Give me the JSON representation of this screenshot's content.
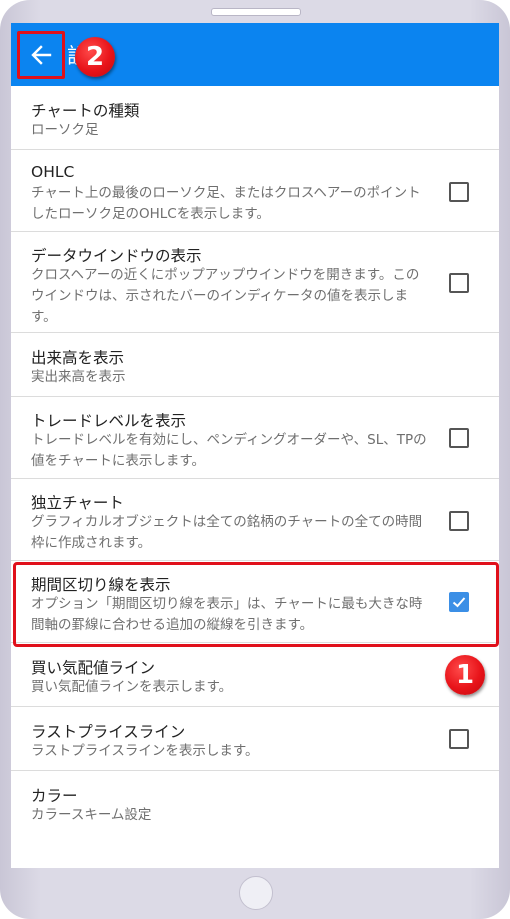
{
  "appbar": {
    "title": "設定",
    "back_icon": "arrow-left-icon",
    "background": "#0b84f0"
  },
  "badges": {
    "one": "1",
    "two": "2"
  },
  "settings": [
    {
      "title": "チャートの種類",
      "desc": "ローソク足",
      "checkbox": null
    },
    {
      "title": "OHLC",
      "desc": "チャート上の最後のローソク足、またはクロスヘアーのポイントしたローソク足のOHLCを表示します。",
      "checkbox": false
    },
    {
      "title": "データウインドウの表示",
      "desc": "クロスヘアーの近くにポップアップウインドウを開きます。このウインドウは、示されたバーのインディケータの値を表示します。",
      "checkbox": false
    },
    {
      "title": "出来高を表示",
      "desc": "実出来高を表示",
      "checkbox": null
    },
    {
      "title": "トレードレベルを表示",
      "desc": "トレードレベルを有効にし、ペンディングオーダーや、SL、TPの値をチャートに表示します。",
      "checkbox": false
    },
    {
      "title": "独立チャート",
      "desc": "グラフィカルオブジェクトは全ての銘柄のチャートの全ての時間枠に作成されます。",
      "checkbox": false
    },
    {
      "title": "期間区切り線を表示",
      "desc": "オプション「期間区切り線を表示」は、チャートに最も大きな時間軸の罫線に合わせる追加の縦線を引きます。",
      "checkbox": true
    },
    {
      "title": "買い気配値ライン",
      "desc": "買い気配値ラインを表示します。",
      "checkbox": null
    },
    {
      "title": "ラストプライスライン",
      "desc": "ラストプライスラインを表示します。",
      "checkbox": false
    },
    {
      "title": "カラー",
      "desc": "カラースキーム設定",
      "checkbox": null
    }
  ],
  "colors": {
    "highlight": "#e0101b",
    "checkbox_checked": "#3b8fe6"
  }
}
